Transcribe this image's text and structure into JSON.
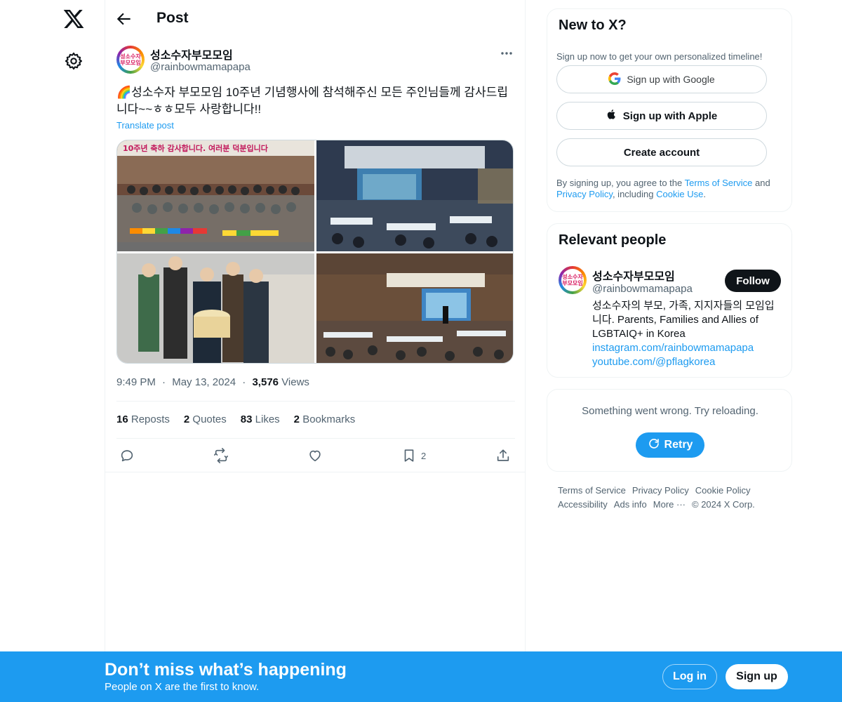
{
  "colors": {
    "accent": "#1d9bf0",
    "text": "#0f1419",
    "muted": "#536471",
    "border": "#eff3f4"
  },
  "nav": {
    "logo_icon": "x-logo-icon",
    "settings_icon": "gear-icon"
  },
  "header": {
    "back_icon": "arrow-left-icon",
    "title": "Post"
  },
  "post": {
    "author_name": "성소수자부모모임",
    "author_handle": "@rainbowmamapapa",
    "avatar_text": [
      "성소수자",
      "부모모임"
    ],
    "text": "🌈성소수자 부모모임 10주년 기념행사에 참석해주신 모든 주인님들께 감사드립니다~~ㅎㅎ모두 사랑합니다!!",
    "translate": "Translate post",
    "photo_banner_1": "10주년 축하 감사합니다. 여러분 덕분입니다",
    "time": "9:49 PM",
    "date": "May 13, 2024",
    "views_count": "3,576",
    "views_label": "Views",
    "stats": [
      {
        "count": "16",
        "label": "Reposts"
      },
      {
        "count": "2",
        "label": "Quotes"
      },
      {
        "count": "83",
        "label": "Likes"
      },
      {
        "count": "2",
        "label": "Bookmarks"
      }
    ],
    "bookmark_count": "2",
    "separator": "·"
  },
  "signup_card": {
    "title": "New to X?",
    "subtitle": "Sign up now to get your own personalized timeline!",
    "google": "Sign up with Google",
    "apple": "Sign up with Apple",
    "create": "Create account",
    "legal_1": "By signing up, you agree to the ",
    "terms": "Terms of Service",
    "legal_2": " and ",
    "privacy": "Privacy Policy",
    "legal_3": ", including ",
    "cookie": "Cookie Use",
    "legal_4": "."
  },
  "people_card": {
    "title": "Relevant people",
    "name": "성소수자부모모임",
    "handle": "@rainbowmamapapa",
    "follow": "Follow",
    "bio": "성소수자의 부모, 가족, 지지자들의 모임입니다. Parents, Families and Allies of LGBTAIQ+ in Korea",
    "link1": "instagram.com/rainbowmamapapa",
    "link2": "youtube.com/@pflagkorea"
  },
  "error_card": {
    "message": "Something went wrong. Try reloading.",
    "retry": "Retry"
  },
  "footer": {
    "links": [
      "Terms of Service",
      "Privacy Policy",
      "Cookie Policy",
      "Accessibility",
      "Ads info",
      "More ···"
    ],
    "copyright": "© 2024 X Corp."
  },
  "banner": {
    "title": "Don’t miss what’s happening",
    "subtitle": "People on X are the first to know.",
    "login": "Log in",
    "signup": "Sign up"
  }
}
